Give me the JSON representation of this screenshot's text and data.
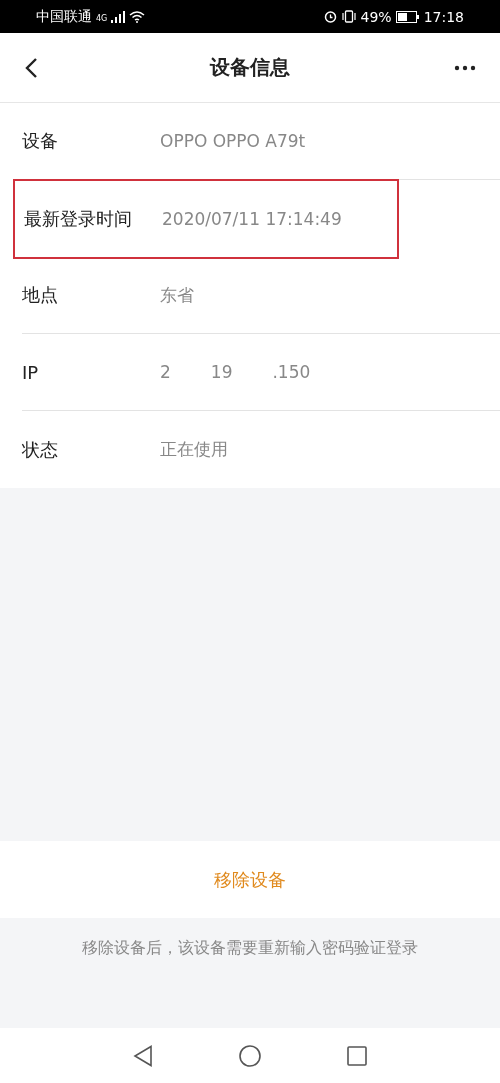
{
  "status_bar": {
    "carrier": "中国联通",
    "network": "4G",
    "battery": "49%",
    "time": "17:18"
  },
  "header": {
    "title": "设备信息"
  },
  "rows": [
    {
      "label": "设备",
      "value": [
        "OPPO OPPO A79t"
      ],
      "highlighted": false
    },
    {
      "label": "最新登录时间",
      "value": [
        "2020/07/11 17:14:49"
      ],
      "highlighted": true
    },
    {
      "label": "地点",
      "value": [
        "东省"
      ],
      "highlighted": false
    },
    {
      "label": "IP",
      "value": [
        "2",
        "19",
        ".150"
      ],
      "highlighted": false
    },
    {
      "label": "状态",
      "value": [
        "正在使用"
      ],
      "highlighted": false
    }
  ],
  "remove_button": "移除设备",
  "note": "移除设备后，该设备需要重新输入密码验证登录"
}
